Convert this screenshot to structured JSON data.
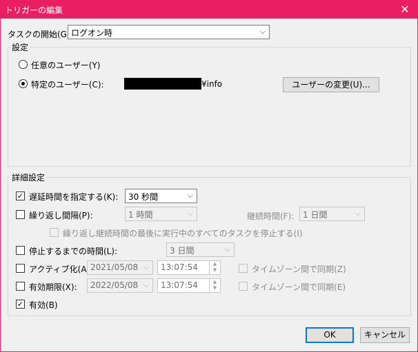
{
  "window": {
    "title": "トリガーの編集",
    "close_glyph": "✕"
  },
  "start_task": {
    "label": "タスクの開始(G):",
    "value": "ログオン時"
  },
  "settings": {
    "heading": "設定",
    "any_user_label": "任意のユーザー(Y)",
    "specific_user_label": "特定のユーザー(C):",
    "user_suffix": "¥info",
    "change_user_button": "ユーザーの変更(U)..."
  },
  "advanced": {
    "heading": "詳細設定",
    "delay": {
      "label": "遅延時間を指定する(K):",
      "checked": true,
      "value": "30 秒間"
    },
    "repeat": {
      "label": "繰り返し間隔(P):",
      "checked": false,
      "value": "1 時間"
    },
    "duration": {
      "label": "継続時間(F):",
      "value": "1 日間"
    },
    "stop_repeat": {
      "label": "繰り返し継続時間の最後に実行中のすべてのタスクを停止する(I)",
      "checked": false
    },
    "stop_after": {
      "label": "停止するまでの時間(L):",
      "checked": false,
      "value": "3 日間"
    },
    "activate": {
      "label": "アクティブ化(A):",
      "checked": false,
      "date": "2021/05/08",
      "time": "13:07:54",
      "sync_label": "タイムゾーン間で同期(Z)"
    },
    "expire": {
      "label": "有効期限(X):",
      "checked": false,
      "date": "2022/05/08",
      "time": "13:07:54",
      "sync_label": "タイムゾーン間で同期(E)"
    },
    "enabled": {
      "label": "有効(B)",
      "checked": true
    }
  },
  "buttons": {
    "ok": "OK",
    "cancel": "キャンセル"
  },
  "glyphs": {
    "dropdown": "⌵",
    "check": "✓",
    "up": "▲",
    "down": "▼"
  }
}
